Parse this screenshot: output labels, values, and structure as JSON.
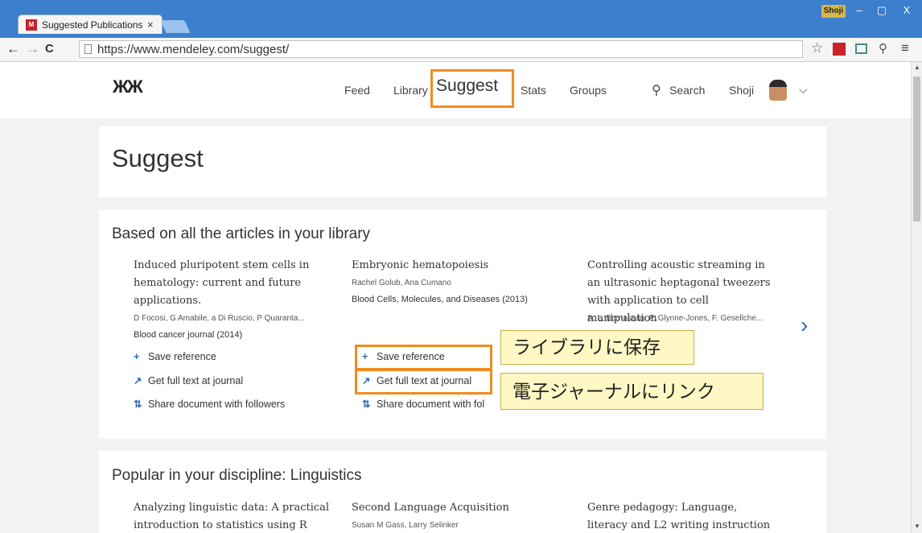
{
  "browser": {
    "tab_title": "Suggested Publications",
    "tab_close": "×",
    "favicon_text": "M",
    "user_badge": "Shoji",
    "window_buttons": [
      "–",
      "▢",
      "X"
    ],
    "url": "https://www.mendeley.com/suggest/",
    "nav_back": "←",
    "nav_forward": "→",
    "nav_reload": "C",
    "icons": [
      "star-icon",
      "mendeley-extension-icon",
      "cast-icon",
      "zoom-icon",
      "menu-icon"
    ]
  },
  "header": {
    "logo": "ЖЖ",
    "nav": {
      "feed": "Feed",
      "library": "Library",
      "suggest": "Suggest",
      "stats": "Stats",
      "groups": "Groups",
      "search": "Search",
      "user": "Shoji"
    }
  },
  "page": {
    "title": "Suggest"
  },
  "based_section": {
    "title": "Based on all the articles in your library",
    "articles": [
      {
        "title": "Induced pluripotent stem cells in hematology: current and future applications.",
        "authors": "D Focosi, G Amabile, a Di Ruscio, P Quaranta...",
        "journal": "Blood cancer journal (2014)"
      },
      {
        "title": "Embryonic hematopoiesis",
        "authors": "Rachel Golub, Ana Cumano",
        "journal": "Blood Cells, Molecules, and Diseases (2013)"
      },
      {
        "title": "Controlling acoustic streaming in an ultrasonic heptagonal tweezers with application to cell manipulation",
        "authors": "A. L. Bernassau, P. Glynne-Jones, F. Gesellche...",
        "journal": ""
      }
    ],
    "actions": {
      "save": "Save reference",
      "fulltext": "Get full text at journal",
      "share": "Share document with followers",
      "share_truncated": "Share document with fol"
    },
    "next": "›"
  },
  "callouts": {
    "save": "ライブラリに保存",
    "link": "電子ジャーナルにリンク"
  },
  "popular_section": {
    "title": "Popular in your discipline: Linguistics",
    "articles": [
      {
        "title": "Analyzing linguistic data: A practical introduction to statistics using R",
        "authors": ""
      },
      {
        "title": "Second Language Acquisition",
        "authors": "Susan M Gass, Larry Selinker"
      },
      {
        "title": "Genre pedagogy: Language, literacy and L2 writing instruction",
        "authors": ""
      }
    ]
  },
  "colors": {
    "highlight": "#f08c1e",
    "accent": "#2a6db0",
    "callout_bg": "#fff8c4"
  }
}
